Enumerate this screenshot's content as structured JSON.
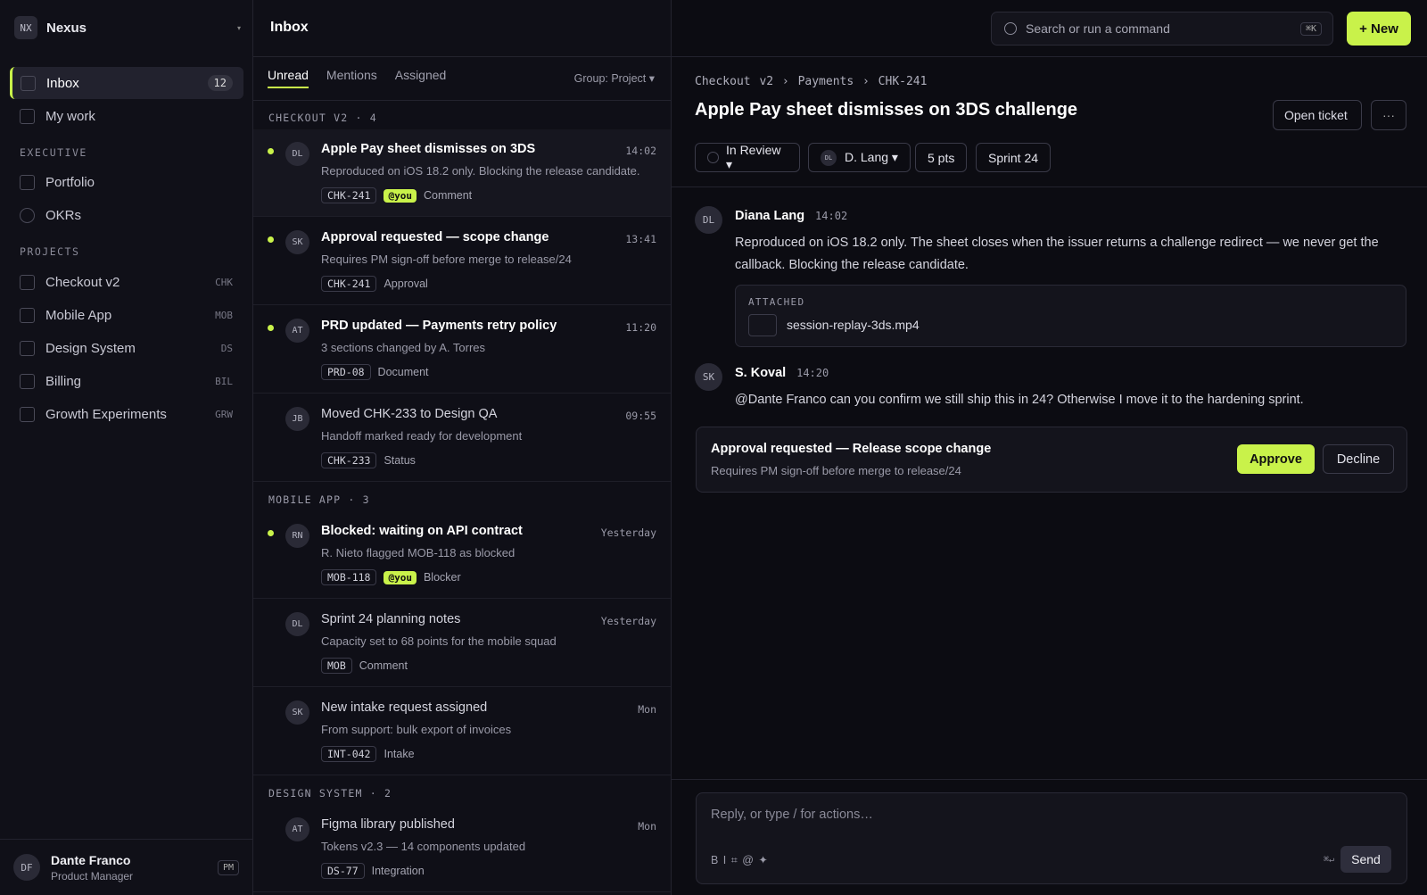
{
  "workspace": {
    "badge": "NX",
    "name": "Nexus",
    "caret": "▾"
  },
  "sidebar": {
    "inbox": {
      "label": "Inbox",
      "count": "12"
    },
    "mywork": {
      "label": "My work"
    },
    "sections": {
      "executive": "EXECUTIVE",
      "projects": "PROJECTS"
    },
    "executive": [
      {
        "label": "Portfolio",
        "shape": "square"
      },
      {
        "label": "OKRs",
        "shape": "circle"
      }
    ],
    "projects": [
      {
        "label": "Checkout v2",
        "code": "CHK"
      },
      {
        "label": "Mobile App",
        "code": "MOB"
      },
      {
        "label": "Design System",
        "code": "DS"
      },
      {
        "label": "Billing",
        "code": "BIL"
      },
      {
        "label": "Growth Experiments",
        "code": "GRW"
      }
    ],
    "user": {
      "initials": "DF",
      "name": "Dante Franco",
      "role": "Product Manager",
      "tag": "PM"
    }
  },
  "topbar": {
    "title": "Inbox",
    "search_placeholder": "Search or run a command",
    "search_kbd": "⌘K",
    "new_label": "+ New"
  },
  "list": {
    "tabs": [
      "Unread",
      "Mentions",
      "Assigned"
    ],
    "group_select": "Group: Project ▾",
    "groups": [
      {
        "title": "CHECKOUT V2 · 4"
      },
      {
        "title": "MOBILE APP · 3"
      },
      {
        "title": "DESIGN SYSTEM · 2"
      }
    ],
    "rows": [
      {
        "initials": "DL",
        "title": "Apple Pay sheet dismisses on 3DS",
        "time": "14:02",
        "sub": "Reproduced on iOS 18.2 only. Blocking the release candidate.",
        "tag": "CHK-241",
        "you": "@you",
        "kind": "Comment"
      },
      {
        "initials": "SK",
        "title": "Approval requested — scope change",
        "time": "13:41",
        "sub": "Requires PM sign-off before merge to release/24",
        "tag": "CHK-241",
        "you": "",
        "kind": "Approval"
      },
      {
        "initials": "AT",
        "title": "PRD updated — Payments retry policy",
        "time": "11:20",
        "sub": "3 sections changed by A. Torres",
        "tag": "PRD-08",
        "you": "",
        "kind": "Document"
      },
      {
        "initials": "JB",
        "title": "Moved CHK-233 to Design QA",
        "time": "09:55",
        "sub": "Handoff marked ready for development",
        "tag": "CHK-233",
        "you": "",
        "kind": "Status"
      },
      {
        "initials": "RN",
        "title": "Blocked: waiting on API contract",
        "time": "Yesterday",
        "sub": "R. Nieto flagged MOB-118 as blocked",
        "tag": "MOB-118",
        "you": "@you",
        "kind": "Blocker"
      },
      {
        "initials": "DL",
        "title": "Sprint 24 planning notes",
        "time": "Yesterday",
        "sub": "Capacity set to 68 points for the mobile squad",
        "tag": "MOB",
        "you": "",
        "kind": "Comment"
      },
      {
        "initials": "SK",
        "title": "New intake request assigned",
        "time": "Mon",
        "sub": "From support: bulk export of invoices",
        "tag": "INT-042",
        "you": "",
        "kind": "Intake"
      },
      {
        "initials": "AT",
        "title": "Figma library published",
        "time": "Mon",
        "sub": "Tokens v2.3 — 14 components updated",
        "tag": "DS-77",
        "you": "",
        "kind": "Integration"
      }
    ]
  },
  "detail": {
    "breadcrumb": "Checkout v2 › Payments › CHK-241",
    "title": "Apple Pay sheet dismisses on 3DS challenge",
    "open_ticket": "Open ticket",
    "more": "···",
    "status": "In Review ▾",
    "assignee_initials": "DL",
    "assignee": "D. Lang ▾",
    "points": "5 pts",
    "sprint": "Sprint 24",
    "messages": [
      {
        "initials": "DL",
        "name": "Diana Lang",
        "time": "14:02",
        "body": "Reproduced on iOS 18.2 only. The sheet closes when the issuer returns a challenge redirect — we never get the callback. Blocking the release candidate."
      },
      {
        "initials": "SK",
        "name": "S. Koval",
        "time": "14:20",
        "body": "@Dante Franco can you confirm we still ship this in 24? Otherwise I move it to the hardening sprint."
      }
    ],
    "attachment": {
      "label": "ATTACHED",
      "name": "session-replay-3ds.mp4"
    },
    "approval": {
      "title": "Approval requested — Release scope change",
      "sub": "Requires PM sign-off before merge to release/24",
      "approve": "Approve",
      "decline": "Decline"
    },
    "composer": {
      "placeholder": "Reply, or type / for actions…",
      "tools": "B I ⌗ @ ✦",
      "kbd": "⌘↵",
      "send": "Send"
    }
  },
  "colors": {
    "accent": "#c9f24a",
    "bg": "#0d0d14"
  }
}
